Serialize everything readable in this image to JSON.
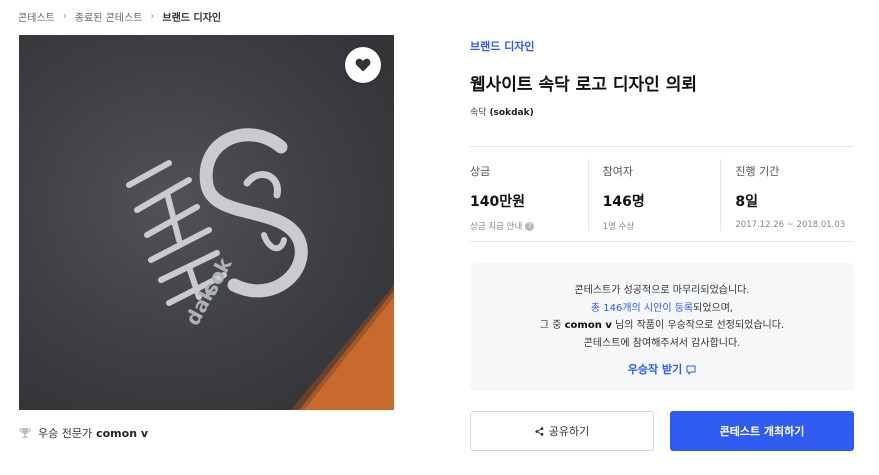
{
  "breadcrumb": {
    "items": [
      "콘테스트",
      "종료된 콘테스트",
      "브랜드 디자인"
    ]
  },
  "hero": {
    "alt_icon": "heart-icon",
    "logo_text_top": "sok",
    "logo_text_bottom": "dak"
  },
  "winner": {
    "label": "우승 전문가",
    "name": "comon v"
  },
  "contest": {
    "category": "브랜드 디자인",
    "title": "웹사이트 속닥 로고 디자인 의뢰",
    "owner_name": "속닥",
    "owner_id": "(sokdak)"
  },
  "stats": [
    {
      "label": "상금",
      "value": "140만원",
      "sub": "상금 지급 안내"
    },
    {
      "label": "참여자",
      "value": "146명",
      "sub": "1명 수상"
    },
    {
      "label": "진행 기간",
      "value": "8일",
      "sub": "2017.12.26 ~ 2018.01.03"
    }
  ],
  "notice": {
    "line1": "콘테스트가 성공적으로 마무리되었습니다.",
    "line2_highlight": "총 146개의 시안이 등록",
    "line2_rest": "되었으며,",
    "line3_pre": "그 중 ",
    "line3_name": "comon v",
    "line3_post": " 님의 작품이 우승작으로 선정되었습니다.",
    "line4": "콘테스트에 참여해주셔서 감사합니다.",
    "cta": "우승작 받기"
  },
  "actions": {
    "share": "공유하기",
    "host": "콘테스트 개최하기"
  },
  "colors": {
    "accent": "#2f5bf0",
    "link": "#2e5ae6"
  }
}
